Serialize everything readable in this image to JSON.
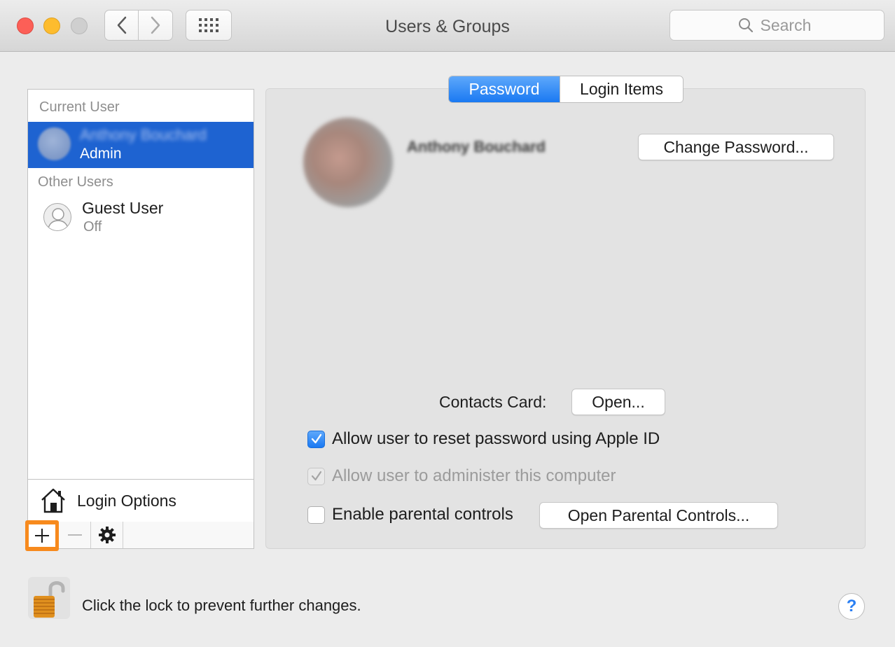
{
  "window": {
    "title": "Users & Groups"
  },
  "search": {
    "placeholder": "Search"
  },
  "sidebar": {
    "current_user_header": "Current User",
    "other_users_header": "Other Users",
    "current_user": {
      "name": "Anthony Bouchard",
      "role": "Admin"
    },
    "guest_user": {
      "name": "Guest User",
      "status": "Off"
    },
    "login_options_label": "Login Options"
  },
  "tabs": [
    {
      "label": "Password",
      "active": true
    },
    {
      "label": "Login Items",
      "active": false
    }
  ],
  "profile": {
    "name": "Anthony Bouchard",
    "change_password_label": "Change Password..."
  },
  "contacts": {
    "label": "Contacts Card:",
    "open_label": "Open..."
  },
  "options": [
    {
      "label": "Allow user to reset password using Apple ID",
      "state": "checked"
    },
    {
      "label": "Allow user to administer this computer",
      "state": "checked-disabled"
    },
    {
      "label": "Enable parental controls",
      "state": "unchecked"
    }
  ],
  "parental_controls_button": "Open Parental Controls...",
  "footer": {
    "lock_text": "Click the lock to prevent further changes.",
    "help_label": "?"
  },
  "colors": {
    "accent": "#1e63d1",
    "highlight_callout": "#f78a1d"
  },
  "icons": [
    "close-icon",
    "minimize-icon",
    "zoom-icon",
    "chevron-left-icon",
    "chevron-right-icon",
    "grid-icon",
    "search-icon",
    "house-icon",
    "plus-icon",
    "minus-icon",
    "gear-icon",
    "lock-icon",
    "help-icon",
    "checkmark-icon",
    "person-icon"
  ]
}
